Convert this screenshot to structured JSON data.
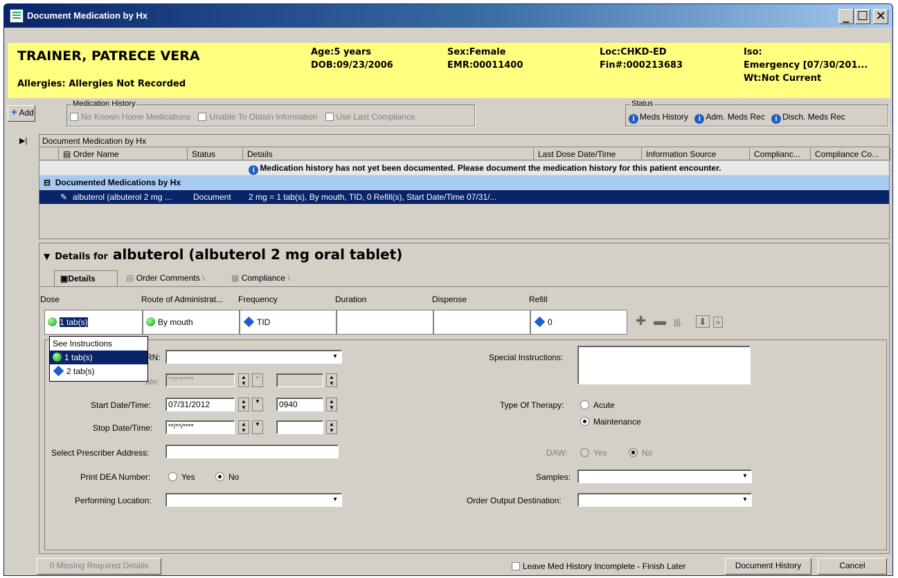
{
  "window": {
    "title": "Document Medication by Hx",
    "minimize": "_",
    "maximize": "☐",
    "close": "✕"
  },
  "banner": {
    "patient_name": "TRAINER, PATRECE VERA",
    "allergies": "Allergies: Allergies Not Recorded",
    "age": "Age:5 years",
    "dob": "DOB:09/23/2006",
    "sex": "Sex:Female",
    "emr": "EMR:00011400",
    "loc": "Loc:CHKD-ED",
    "fin": "Fin#:000213683",
    "iso": "Iso:",
    "emergency": "Emergency [07/30/201...",
    "wt": "Wt:Not Current"
  },
  "toolbar": {
    "add_label": "Add",
    "med_history_legend": "Medication History",
    "no_known": "No Known Home Medications",
    "unable": "Unable To Obtain Information",
    "use_last": "Use Last Compliance",
    "status_legend": "Status",
    "meds_history": "Meds History",
    "adm_meds_rec": "Adm. Meds Rec",
    "disch_meds_rec": "Disch. Meds Rec"
  },
  "grid": {
    "group_title": "Document Medication by Hx",
    "columns": [
      "Order Name",
      "Status",
      "Details",
      "Last Dose Date/Time",
      "Information Source",
      "Complianc...",
      "Compliance Co..."
    ],
    "notice": "Medication history has not yet been documented. Please document the medication history for this patient encounter.",
    "section": "Documented Medications by Hx",
    "row": {
      "name": "albuterol (albuterol 2 mg ...",
      "status": "Document",
      "details": "2 mg = 1 tab(s), By mouth, TID, 0 Refill(s), Start Date/Time 07/31/..."
    }
  },
  "details": {
    "prefix": "Details for",
    "drug": "albuterol (albuterol 2 mg oral tablet)",
    "tabs": [
      "Details",
      "Order Comments",
      "Compliance"
    ],
    "headers": {
      "dose": "Dose",
      "route": "Route of Administrat...",
      "frequency": "Frequency",
      "duration": "Duration",
      "dispense": "Dispense",
      "refill": "Refill"
    },
    "values": {
      "dose": "1 tab(s)",
      "route": "By mouth",
      "frequency": "TID",
      "refill": "0"
    },
    "dropdown": [
      "See Instructions",
      "1 tab(s)",
      "2 tab(s)"
    ]
  },
  "form": {
    "prn_label": "RN:",
    "requested_label": "ate:",
    "requested_value": "**/**/****",
    "start_label": "Start Date/Time:",
    "start_date": "07/31/2012",
    "start_time": "0940",
    "stop_label": "Stop Date/Time:",
    "stop_date": "**/**/****",
    "prescriber_label": "Select Prescriber Address:",
    "dea_label": "Print DEA Number:",
    "yes": "Yes",
    "no": "No",
    "performing_label": "Performing Location:",
    "special_label": "Special Instructions:",
    "therapy_label": "Type Of Therapy:",
    "acute": "Acute",
    "maintenance": "Maintenance",
    "daw_label": "DAW:",
    "samples_label": "Samples:",
    "output_label": "Order Output Destination:"
  },
  "footer": {
    "missing": "0 Missing Required Details",
    "leave_incomplete": "Leave Med History Incomplete - Finish Later",
    "document_history": "Document History",
    "cancel": "Cancel"
  }
}
